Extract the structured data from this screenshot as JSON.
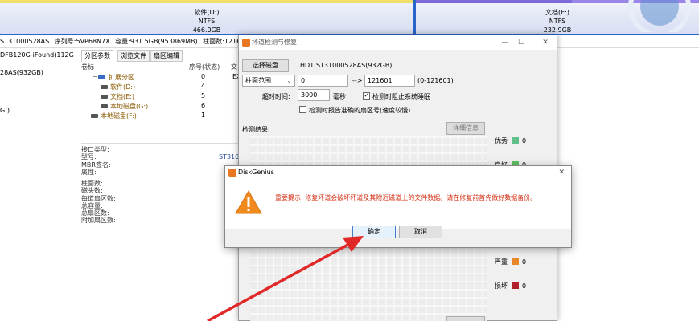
{
  "partitions": [
    {
      "label": "软件(D:)",
      "fs": "NTFS",
      "size": "466.0GB"
    },
    {
      "label": "文档(E:)",
      "fs": "NTFS",
      "size": "232.9GB"
    }
  ],
  "disk_info": {
    "model": "ST31000528AS",
    "serial": "序列号:5VP68N7X",
    "capacity": "容量:931.5GB(953869MB)",
    "cylinders": "柱面数:121601"
  },
  "left_tree": {
    "disk2": "DFB120G-iFound(112G",
    "disk1": "28AS(932GB)",
    "g": "G:)"
  },
  "tabs": [
    "分区参数",
    "浏览文件",
    "扇区编辑"
  ],
  "grid": {
    "col_volume": "卷标",
    "col_seq": "序号(状态)",
    "col_fs": "文",
    "rows": [
      {
        "name": "扩展分区",
        "seq": "0",
        "fs": "EX"
      },
      {
        "name": "软件(D:)",
        "seq": "4",
        "fs": ""
      },
      {
        "name": "文档(E:)",
        "seq": "5",
        "fs": ""
      },
      {
        "name": "本地磁盘(G:)",
        "seq": "6",
        "fs": ""
      },
      {
        "name": "本地磁盘(F:)",
        "seq": "1",
        "fs": ""
      }
    ]
  },
  "properties": {
    "group1": [
      "接口类型:",
      "型号:",
      "MBR签名:",
      "属性:"
    ],
    "group2": [
      "柱面数:",
      "磁头数:",
      "每道扇区数:",
      "总容量:",
      "总扇区数:",
      "附加扇区数:"
    ],
    "model_value": "ST310"
  },
  "scan_dialog": {
    "title": "坏道检测与修复",
    "select_disk_button": "选择磁盘",
    "disk_name": "HD1:ST31000528AS(932GB)",
    "range_mode": "柱面范围",
    "range_from": "0",
    "range_arrow": "-->",
    "range_to": "121601",
    "range_hint": "(0-121601)",
    "timeout_label": "超时时间:",
    "timeout_value": "3000",
    "timeout_unit": "毫秒",
    "cb_sleep": "检测时阻止系统睡眠",
    "cb_report": "检测时报告准确的扇区号(速度较慢)",
    "results_label": "检测结果:",
    "detail_button": "详细信息",
    "legend": [
      {
        "label": "优秀",
        "count": "0",
        "color": "#5fc08c"
      },
      {
        "label": "良好",
        "count": "0",
        "color": "#5fc05f"
      },
      {
        "label": "严重",
        "count": "0",
        "color": "#e8862a"
      },
      {
        "label": "损坏",
        "count": "0",
        "color": "#b0202a"
      }
    ]
  },
  "confirm_dialog": {
    "title": "DiskGenius",
    "message": "重要提示: 修复坏道会破坏坏道及其附近磁道上的文件数据。请在修复前首先做好数据备份。",
    "ok_label": "确定",
    "cancel_label": "取消"
  }
}
